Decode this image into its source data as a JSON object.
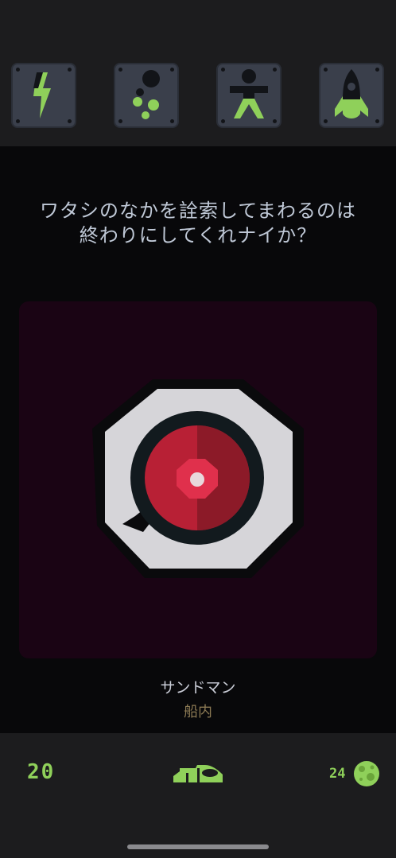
{
  "message": {
    "line1": "ワタシのなかを詮索してまわるのは",
    "line2": "終わりにしてくれナイか？"
  },
  "character": {
    "name": "サンドマン",
    "location": "船内"
  },
  "footer": {
    "left_count": "20",
    "right_count": "24"
  },
  "icons": {
    "tile1": "lightning-icon",
    "tile2": "bubbles-icon",
    "tile3": "person-icon",
    "tile4": "rocket-icon",
    "center": "sandman-eye-icon",
    "footer_center": "shoe-icon",
    "footer_right": "moon-icon"
  },
  "colors": {
    "accent_green": "#8fd05a",
    "eye_red": "#c0233a",
    "panel_bg": "#1a0414"
  }
}
